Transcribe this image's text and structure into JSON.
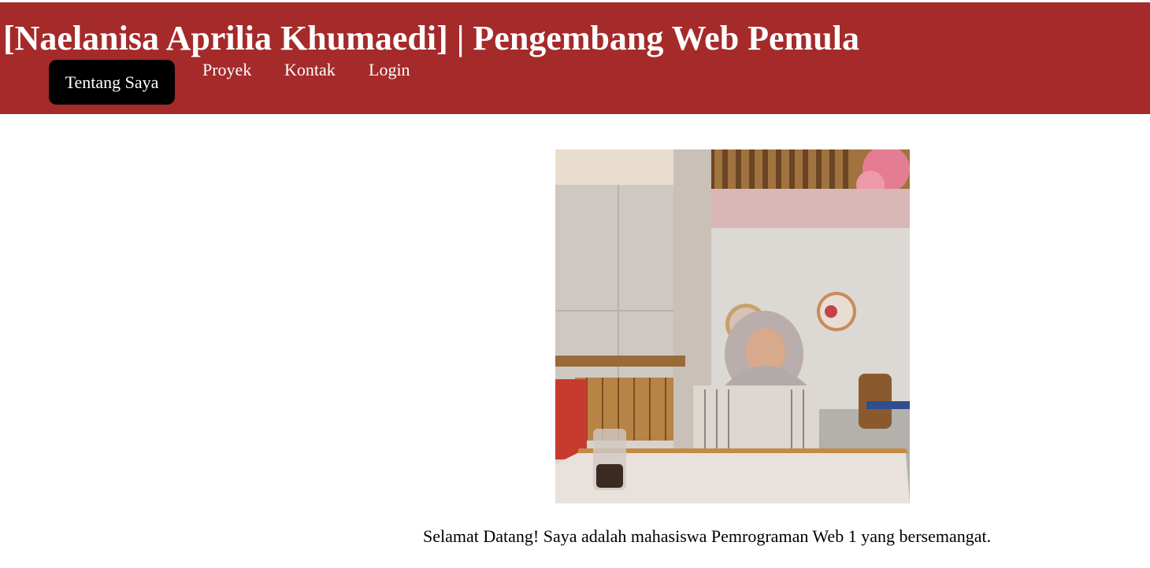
{
  "header": {
    "title": "[Naelanisa Aprilia Khumaedi] | Pengembang Web Pemula",
    "background_color": "#a52a2a"
  },
  "nav": {
    "items": [
      {
        "label": "Tentang Saya",
        "active": true
      },
      {
        "label": "Proyek",
        "active": false
      },
      {
        "label": "Kontak",
        "active": false
      },
      {
        "label": "Login",
        "active": false
      }
    ],
    "active_background": "#000000"
  },
  "main": {
    "welcome_text": "Selamat Datang! Saya adalah mahasiswa Pemrograman Web 1 yang bersemangat."
  }
}
